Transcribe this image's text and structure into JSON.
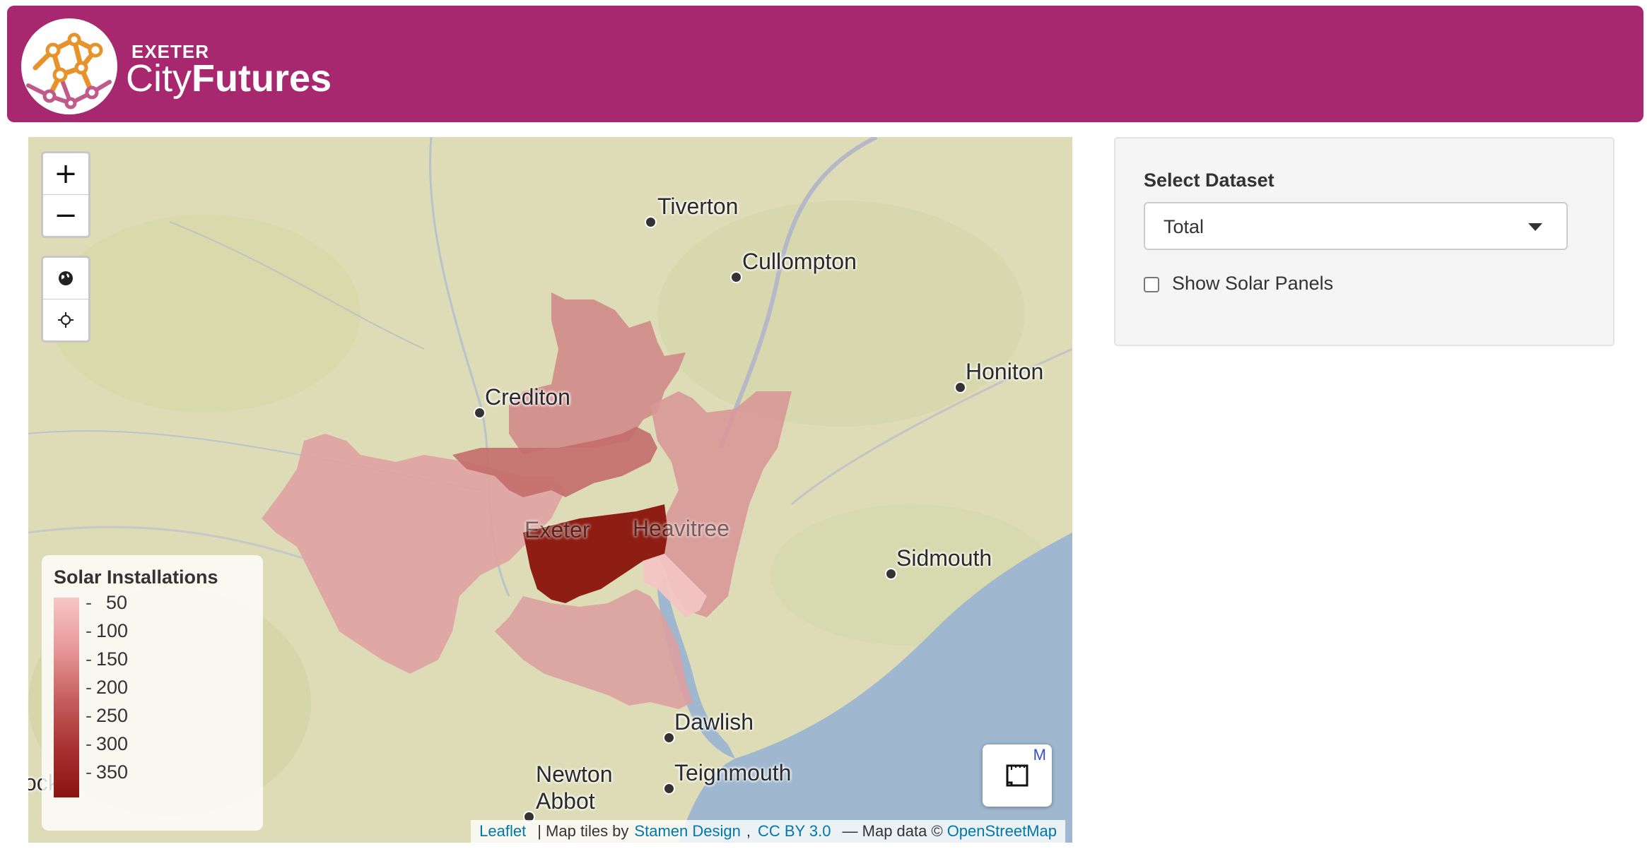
{
  "header": {
    "logo_small": "EXETER",
    "logo_city": "City",
    "logo_futures": "Futures",
    "bg_color": "#a8286f"
  },
  "map": {
    "zoom_in": "+",
    "zoom_out": "−",
    "towns": [
      "Tiverton",
      "Cullompton",
      "Crediton",
      "Honiton",
      "Exeter",
      "Heavitree",
      "Sidmouth",
      "Dawlish",
      "Newton",
      "Abbot",
      "Teignmouth",
      "ock"
    ],
    "legend": {
      "title": "Solar Installations",
      "labels": [
        "50",
        "100",
        "150",
        "200",
        "250",
        "300",
        "350"
      ]
    },
    "fullscreen_icon": "fullscreen-icon",
    "fullscreen_partial": "M",
    "attribution": {
      "leaflet": "Leaflet",
      "tiles_prefix": "| Map tiles by",
      "stamen": "Stamen Design",
      "sep": ",",
      "license": "CC BY 3.0",
      "data_prefix": "— Map data ©",
      "osm": "OpenStreetMap"
    }
  },
  "sidebar": {
    "select_label": "Select Dataset",
    "select_value": "Total",
    "checkbox_label": "Show Solar Panels"
  }
}
